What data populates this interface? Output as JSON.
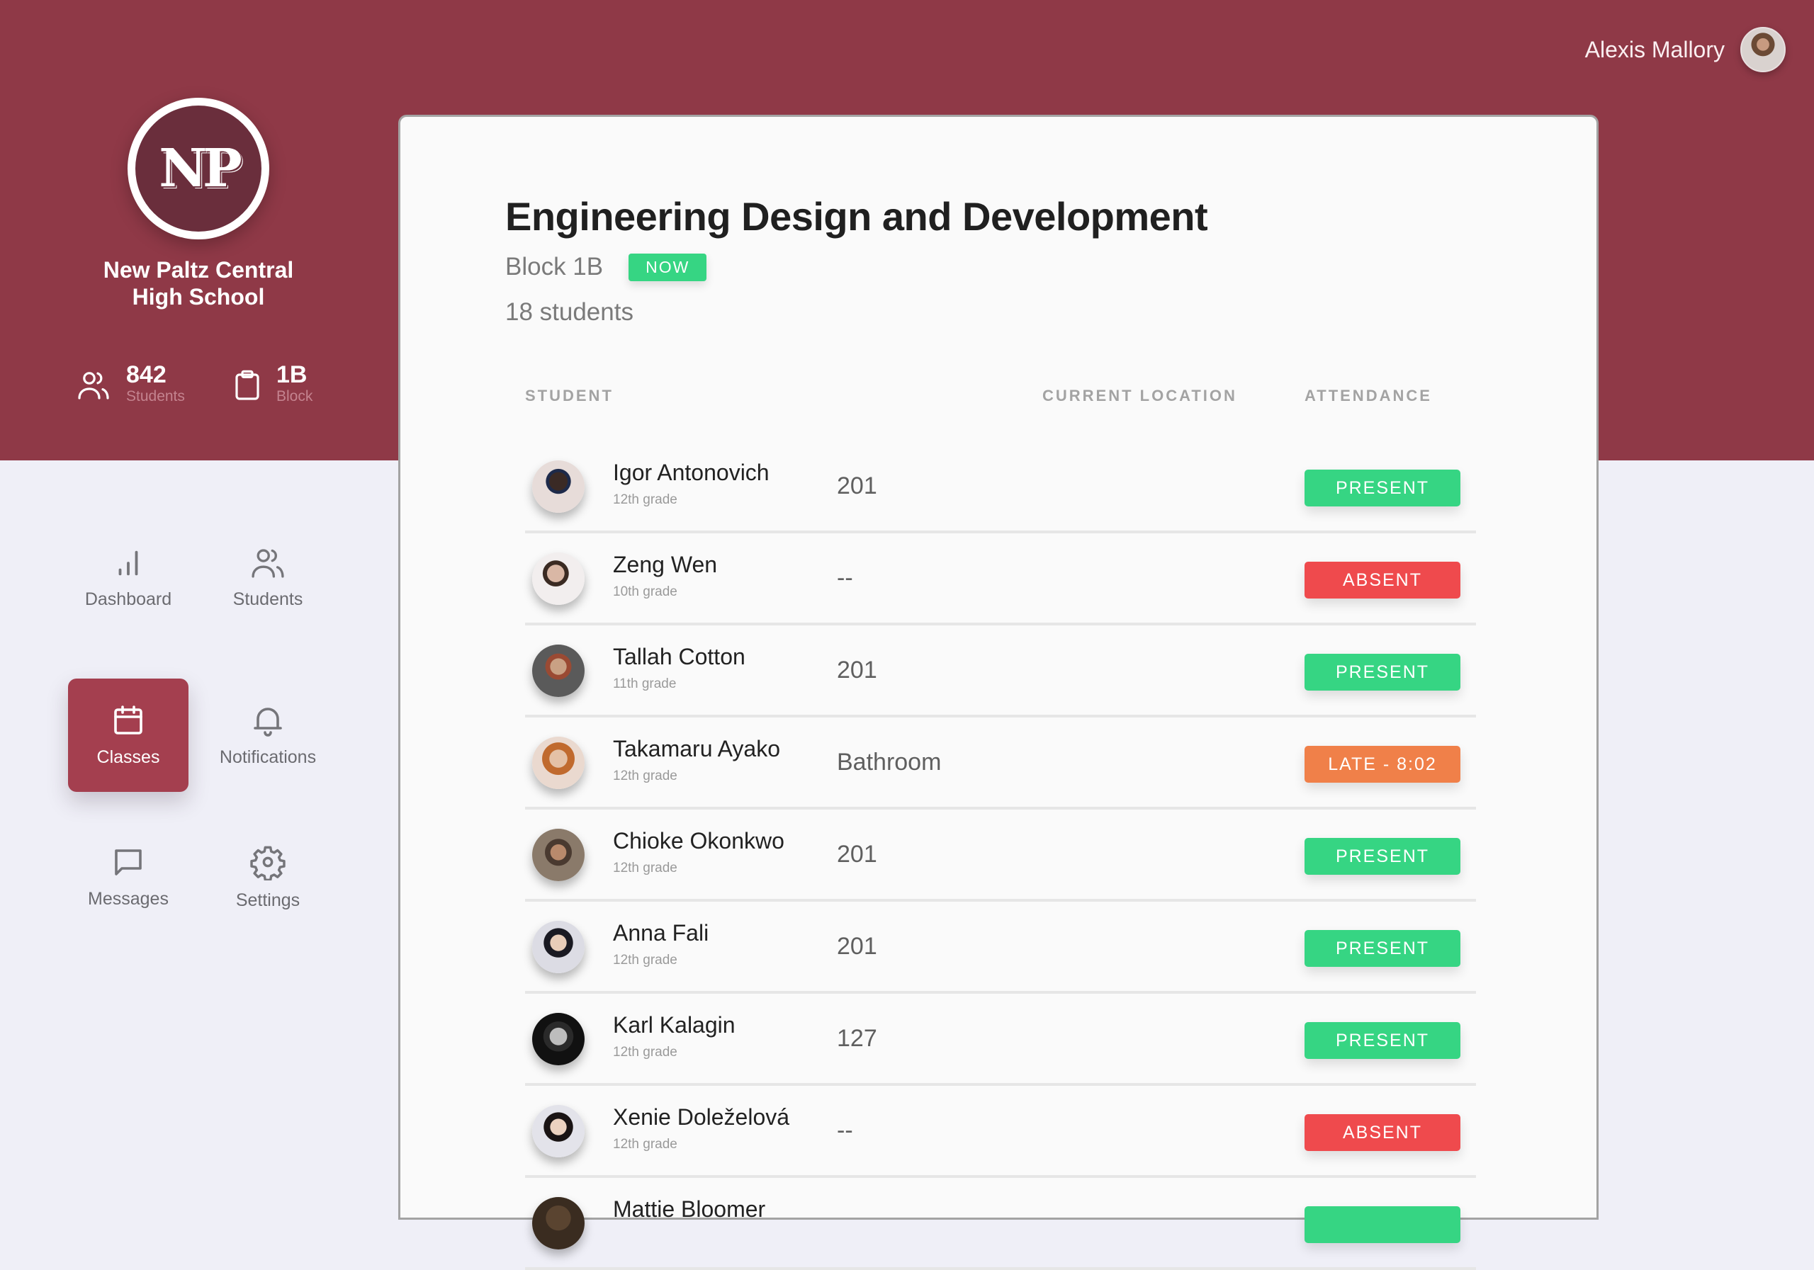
{
  "user": {
    "name": "Alexis Mallory"
  },
  "school": {
    "logo_text": "NP",
    "name_line1": "New Paltz Central",
    "name_line2": "High School"
  },
  "stats": [
    {
      "value": "842",
      "label": "Students",
      "icon": "users-icon"
    },
    {
      "value": "1B",
      "label": "Block",
      "icon": "clipboard-icon"
    }
  ],
  "nav": {
    "dashboard": "Dashboard",
    "students": "Students",
    "classes": "Classes",
    "notifications": "Notifications",
    "messages": "Messages",
    "settings": "Settings",
    "active": "Classes"
  },
  "class": {
    "title": "Engineering Design and Development",
    "block": "Block 1B",
    "badge": "NOW",
    "student_count": "18 students"
  },
  "table": {
    "headers": {
      "student": "STUDENT",
      "location": "CURRENT LOCATION",
      "attendance": "ATTENDANCE"
    },
    "rows": [
      {
        "name": "Igor Antonovich",
        "grade": "12th grade",
        "location": "201",
        "attendance": "PRESENT",
        "status": "present"
      },
      {
        "name": "Zeng Wen",
        "grade": "10th grade",
        "location": "--",
        "attendance": "ABSENT",
        "status": "absent"
      },
      {
        "name": "Tallah Cotton",
        "grade": "11th grade",
        "location": "201",
        "attendance": "PRESENT",
        "status": "present"
      },
      {
        "name": "Takamaru Ayako",
        "grade": "12th grade",
        "location": "Bathroom",
        "attendance": "LATE - 8:02",
        "status": "late"
      },
      {
        "name": "Chioke Okonkwo",
        "grade": "12th grade",
        "location": "201",
        "attendance": "PRESENT",
        "status": "present"
      },
      {
        "name": "Anna Fali",
        "grade": "12th grade",
        "location": "201",
        "attendance": "PRESENT",
        "status": "present"
      },
      {
        "name": "Karl Kalagin",
        "grade": "12th grade",
        "location": "127",
        "attendance": "PRESENT",
        "status": "present"
      },
      {
        "name": "Xenie Doleželová",
        "grade": "12th grade",
        "location": "--",
        "attendance": "ABSENT",
        "status": "absent"
      },
      {
        "name": "Mattie Bloomer",
        "grade": "",
        "location": "",
        "attendance": "",
        "status": "present"
      }
    ]
  },
  "colors": {
    "brand": "#8f3947",
    "active_nav": "#a43f4f",
    "present": "#36d583",
    "absent": "#ef4a4d",
    "late": "#f08049"
  }
}
